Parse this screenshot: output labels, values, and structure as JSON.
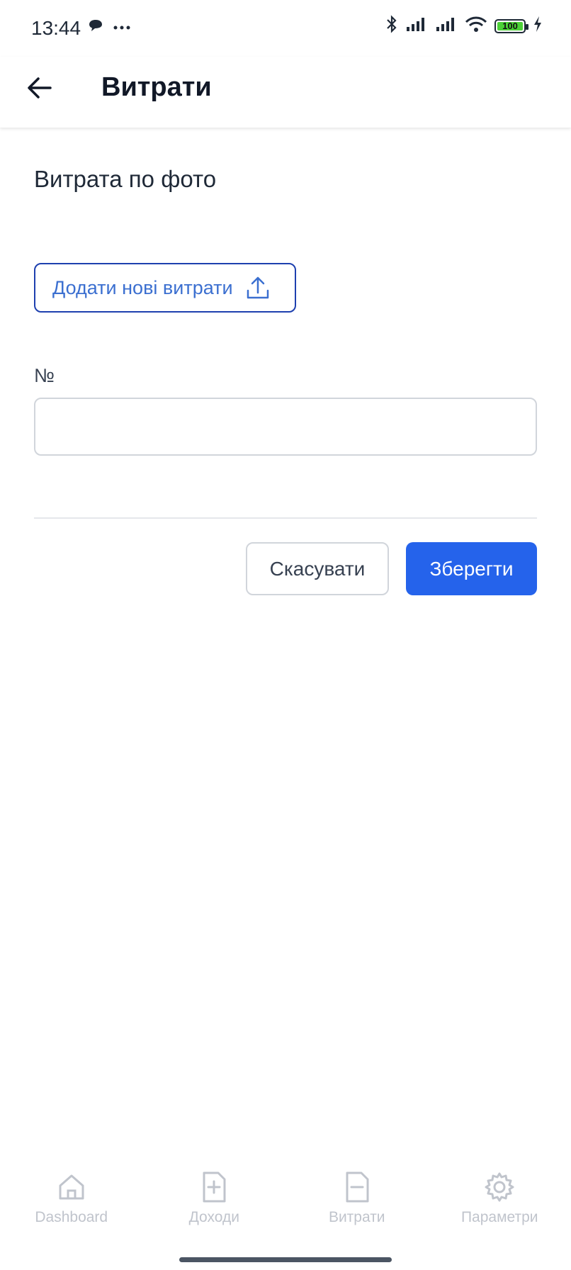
{
  "status_bar": {
    "time": "13:44",
    "left_icons": [
      "chat-bubble-icon",
      "more-dots-icon"
    ],
    "right_icons": [
      "bluetooth-icon",
      "cell-signal-icon",
      "cell-signal-icon",
      "wifi-icon",
      "battery-icon",
      "charging-icon"
    ],
    "battery": "100",
    "battery_color": "#4cd137"
  },
  "app_bar": {
    "title": "Витрати",
    "back_icon": "arrow-left-icon"
  },
  "form": {
    "section_title": "Витрата по фото",
    "upload_label": "Додати нові витрати",
    "upload_icon": "upload-icon",
    "number_label": "№",
    "number_value": "",
    "cancel_label": "Скасувати",
    "save_label": "Зберегти"
  },
  "bottom_nav": {
    "items": [
      {
        "label": "Dashboard",
        "icon": "home-icon"
      },
      {
        "label": "Доходи",
        "icon": "file-plus-icon"
      },
      {
        "label": "Витрати",
        "icon": "file-minus-icon"
      },
      {
        "label": "Параметри",
        "icon": "gear-icon"
      }
    ]
  },
  "colors": {
    "primary": "#2563eb",
    "outline_button": "#1e40af",
    "outline_text": "#3b6fd0",
    "nav_inactive": "#c0c4cc"
  }
}
